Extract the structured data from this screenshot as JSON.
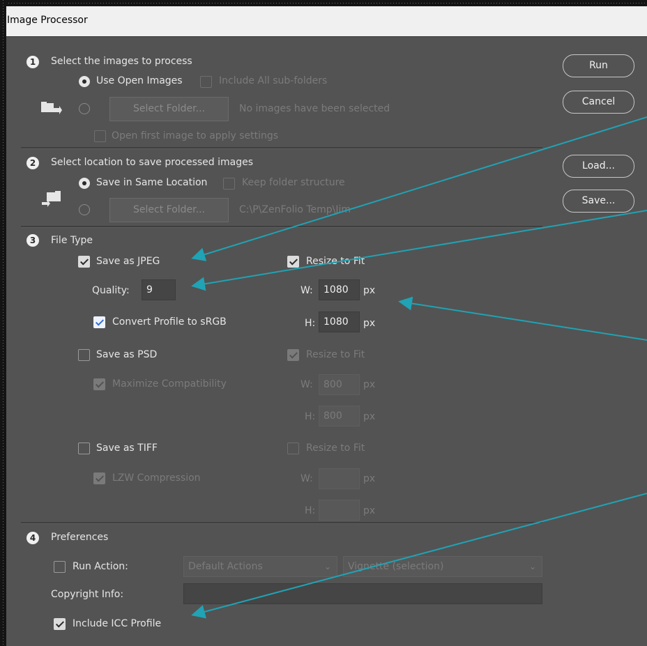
{
  "window": {
    "title": "Image Processor"
  },
  "section1": {
    "number": "1",
    "heading": "Select the images to process",
    "use_open_images": "Use Open Images",
    "include_subfolders": "Include All sub-folders",
    "select_folder": "Select Folder...",
    "no_images": "No images have been selected",
    "open_first": "Open first image to apply settings"
  },
  "section2": {
    "number": "2",
    "heading": "Select location to save processed images",
    "save_same": "Save in Same Location",
    "keep_structure": "Keep folder structure",
    "select_folder": "Select Folder...",
    "folder_path": "C:\\P\\ZenFolio Temp\\Jim"
  },
  "section3": {
    "number": "3",
    "heading": "File Type",
    "jpeg": {
      "label": "Save as JPEG",
      "quality_label": "Quality:",
      "quality_value": "9",
      "convert_profile": "Convert Profile to sRGB",
      "resize": "Resize to Fit",
      "w_label": "W:",
      "w_value": "1080",
      "h_label": "H:",
      "h_value": "1080",
      "unit": "px"
    },
    "psd": {
      "label": "Save as PSD",
      "maximize": "Maximize Compatibility",
      "resize": "Resize to Fit",
      "w_label": "W:",
      "w_value": "800",
      "h_label": "H:",
      "h_value": "800",
      "unit": "px"
    },
    "tiff": {
      "label": "Save as TIFF",
      "lzw": "LZW Compression",
      "resize": "Resize to Fit",
      "w_label": "W:",
      "w_value": "",
      "h_label": "H:",
      "h_value": "",
      "unit": "px"
    }
  },
  "section4": {
    "number": "4",
    "heading": "Preferences",
    "run_action": "Run Action:",
    "action_set": "Default Actions",
    "action_name": "Vignette (selection)",
    "copyright_label": "Copyright Info:",
    "copyright_value": "",
    "include_icc": "Include ICC Profile"
  },
  "buttons": {
    "run": "Run",
    "cancel": "Cancel",
    "load": "Load...",
    "save": "Save..."
  },
  "colors": {
    "panel": "#535353",
    "annotation_arrow": "#1fa3b5",
    "accent_check": "#2d6fd6"
  },
  "icons": [
    "folder-open-icon",
    "folder-save-icon",
    "chevron-down-icon",
    "checkmark-icon"
  ]
}
